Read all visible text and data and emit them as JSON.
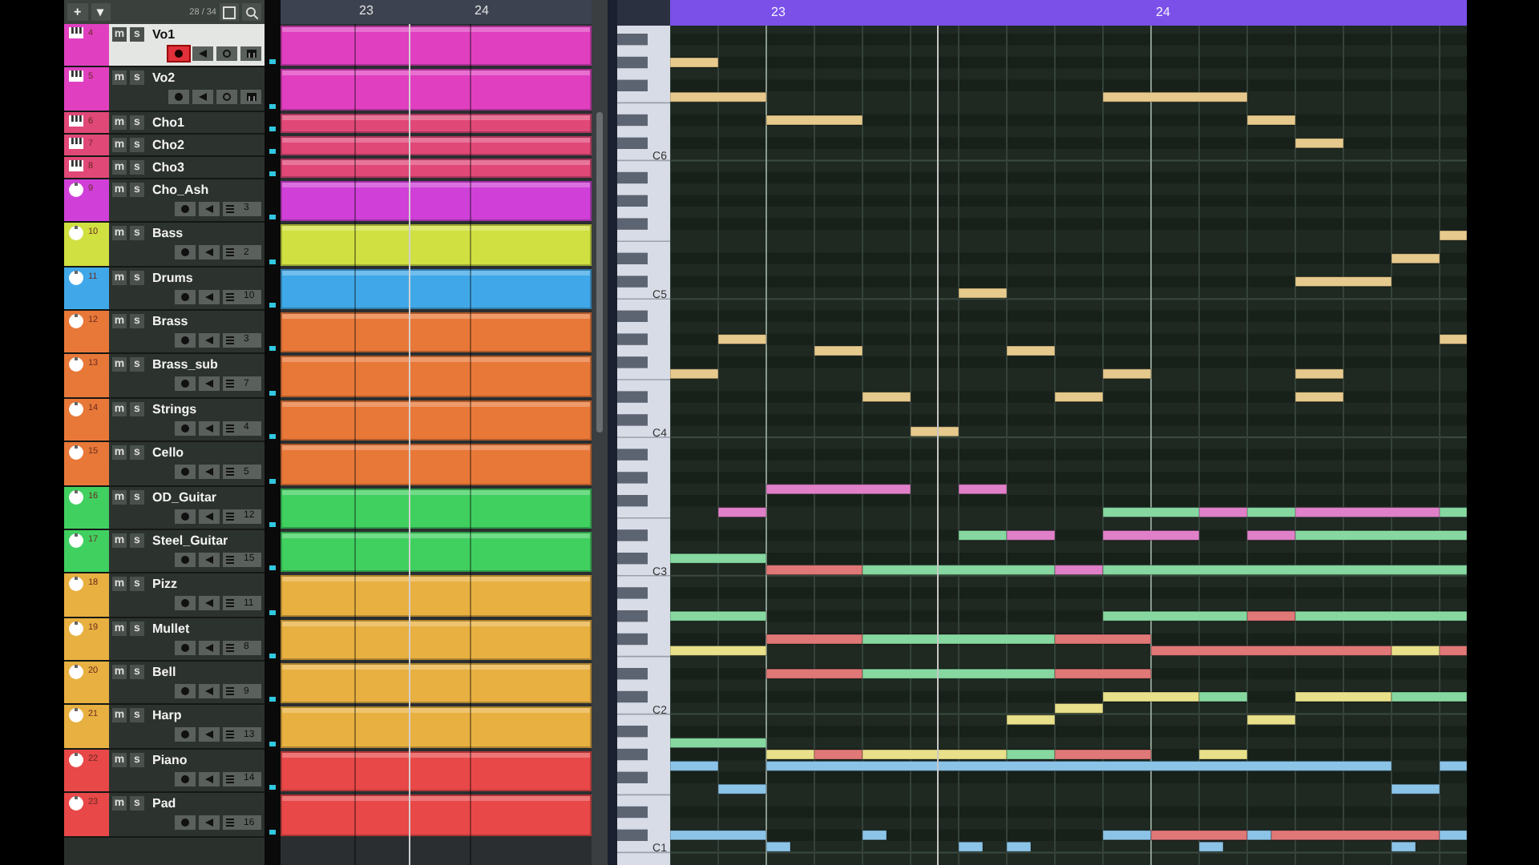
{
  "toolbar": {
    "add": "+",
    "menu": "▾",
    "counter": "28 / 34"
  },
  "tracks": [
    {
      "number": "4",
      "name": "Vo1",
      "color": "#e040c0",
      "kind": "instrument",
      "folded": false,
      "selected": true,
      "record_armed": true,
      "buttons": [
        "m",
        "s"
      ]
    },
    {
      "number": "5",
      "name": "Vo2",
      "color": "#e040c0",
      "kind": "instrument",
      "folded": false,
      "selected": false,
      "record_armed": false,
      "buttons": [
        "m",
        "s"
      ]
    },
    {
      "number": "6",
      "name": "Cho1",
      "color": "#e04878",
      "kind": "instrument",
      "folded": true,
      "selected": false,
      "buttons": [
        "m",
        "s"
      ]
    },
    {
      "number": "7",
      "name": "Cho2",
      "color": "#e04878",
      "kind": "instrument",
      "folded": true,
      "selected": false,
      "buttons": [
        "m",
        "s"
      ]
    },
    {
      "number": "8",
      "name": "Cho3",
      "color": "#e04878",
      "kind": "instrument",
      "folded": true,
      "selected": false,
      "buttons": [
        "m",
        "s"
      ]
    },
    {
      "number": "9",
      "name": "Cho_Ash",
      "color": "#d040d8",
      "kind": "midi",
      "folded": false,
      "selected": false,
      "record_armed": false,
      "buttons": [
        "m",
        "s"
      ],
      "channel": "3"
    },
    {
      "number": "10",
      "name": "Bass",
      "color": "#d0e040",
      "kind": "midi",
      "folded": false,
      "selected": false,
      "record_armed": false,
      "buttons": [
        "m",
        "s"
      ],
      "channel": "2"
    },
    {
      "number": "11",
      "name": "Drums",
      "color": "#40a8e8",
      "kind": "midi",
      "folded": false,
      "selected": false,
      "record_armed": false,
      "buttons": [
        "m",
        "s"
      ],
      "channel": "10"
    },
    {
      "number": "12",
      "name": "Brass",
      "color": "#e87838",
      "kind": "midi",
      "folded": false,
      "selected": false,
      "record_armed": false,
      "buttons": [
        "m",
        "s"
      ],
      "channel": "3"
    },
    {
      "number": "13",
      "name": "Brass_sub",
      "color": "#e87838",
      "kind": "midi",
      "folded": false,
      "selected": false,
      "record_armed": false,
      "buttons": [
        "m",
        "s"
      ],
      "channel": "7"
    },
    {
      "number": "14",
      "name": "Strings",
      "color": "#e87838",
      "kind": "midi",
      "folded": false,
      "selected": false,
      "record_armed": false,
      "buttons": [
        "m",
        "s"
      ],
      "channel": "4"
    },
    {
      "number": "15",
      "name": "Cello",
      "color": "#e87838",
      "kind": "midi",
      "folded": false,
      "selected": false,
      "record_armed": false,
      "buttons": [
        "m",
        "s"
      ],
      "channel": "5"
    },
    {
      "number": "16",
      "name": "OD_Guitar",
      "color": "#40d060",
      "kind": "midi",
      "folded": false,
      "selected": false,
      "record_armed": false,
      "buttons": [
        "m",
        "s"
      ],
      "channel": "12"
    },
    {
      "number": "17",
      "name": "Steel_Guitar",
      "color": "#40d060",
      "kind": "midi",
      "folded": false,
      "selected": false,
      "record_armed": false,
      "buttons": [
        "m",
        "s"
      ],
      "channel": "15"
    },
    {
      "number": "18",
      "name": "Pizz",
      "color": "#e8b040",
      "kind": "midi",
      "folded": false,
      "selected": false,
      "record_armed": false,
      "buttons": [
        "m",
        "s"
      ],
      "channel": "11"
    },
    {
      "number": "19",
      "name": "Mullet",
      "color": "#e8b040",
      "kind": "midi",
      "folded": false,
      "selected": false,
      "record_armed": false,
      "buttons": [
        "m",
        "s"
      ],
      "channel": "8"
    },
    {
      "number": "20",
      "name": "Bell",
      "color": "#e8b040",
      "kind": "midi",
      "folded": false,
      "selected": false,
      "record_armed": false,
      "buttons": [
        "m",
        "s"
      ],
      "channel": "9"
    },
    {
      "number": "21",
      "name": "Harp",
      "color": "#e8b040",
      "kind": "midi",
      "folded": false,
      "selected": false,
      "record_armed": false,
      "buttons": [
        "m",
        "s"
      ],
      "channel": "13"
    },
    {
      "number": "22",
      "name": "Piano",
      "color": "#e84848",
      "kind": "midi",
      "folded": false,
      "selected": false,
      "record_armed": false,
      "buttons": [
        "m",
        "s"
      ],
      "channel": "14"
    },
    {
      "number": "23",
      "name": "Pad",
      "color": "#e84848",
      "kind": "midi",
      "folded": false,
      "selected": false,
      "record_armed": false,
      "buttons": [
        "m",
        "s"
      ],
      "channel": "16"
    }
  ],
  "arrange_ruler": [
    "23",
    "24"
  ],
  "piano_roll": {
    "ruler": [
      "23",
      "24"
    ],
    "octave_labels": [
      "C6",
      "C5",
      "C4",
      "C3",
      "C2",
      "C1"
    ]
  }
}
